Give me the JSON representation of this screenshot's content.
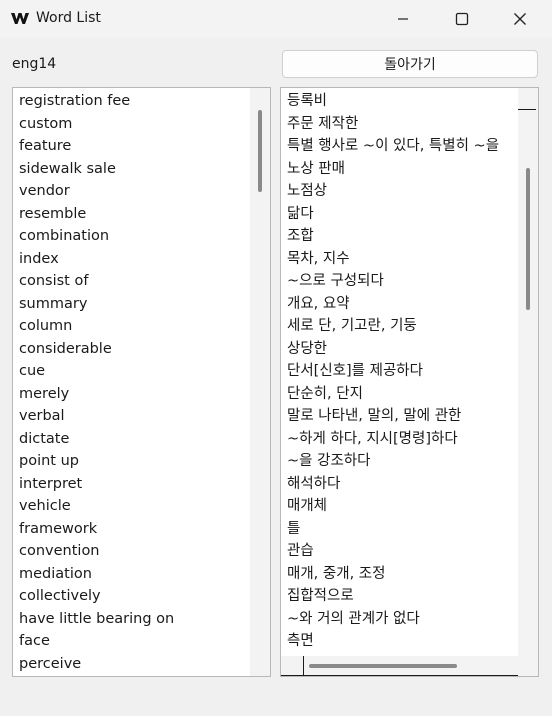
{
  "window": {
    "title": "Word List"
  },
  "header": {
    "deck_label": "eng14",
    "back_button_label": "돌아가기"
  },
  "words": [
    "registration fee",
    "custom",
    "feature",
    "sidewalk sale",
    "vendor",
    "resemble",
    "combination",
    "index",
    "consist of",
    "summary",
    "column",
    "considerable",
    "cue",
    "merely",
    "verbal",
    "dictate",
    "point up",
    "interpret",
    "vehicle",
    "framework",
    "convention",
    "mediation",
    "collectively",
    "have little bearing on",
    "face",
    "perceive"
  ],
  "meanings": [
    "등록비",
    "주문 제작한",
    "특별 행사로 ~이 있다, 특별히 ~을",
    "노상 판매",
    "노점상",
    "닮다",
    "조합",
    "목차, 지수",
    "~으로 구성되다",
    "개요, 요약",
    "세로 단, 기고란, 기둥",
    "상당한",
    "단서[신호]를 제공하다",
    "단순히, 단지",
    "말로 나타낸, 말의, 말에 관한",
    "~하게 하다, 지시[명령]하다",
    "~을 강조하다",
    "해석하다",
    "매개체",
    "틀",
    "관습",
    "매개, 중개, 조정",
    "집합적으로",
    "~와 거의 관계가 없다",
    "측면"
  ],
  "scroll": {
    "words_list_visible_fraction": 0.28,
    "meanings_list_visible_fraction": 0.25,
    "meanings_list_horizontal_visible_fraction": 0.62
  }
}
